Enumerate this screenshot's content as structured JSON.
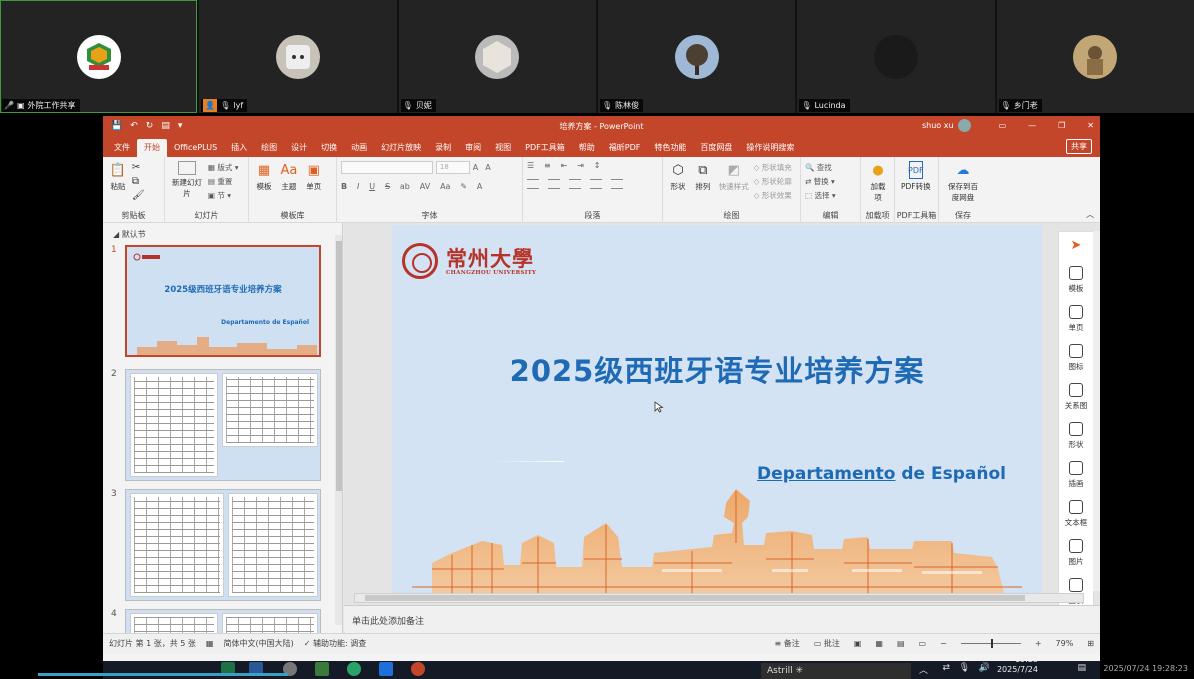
{
  "participants": [
    {
      "name": "外院工作共享",
      "active": true,
      "avatar": "university-logo"
    },
    {
      "name": "lyf",
      "active": false,
      "avatar": "cat-photo"
    },
    {
      "name": "贝妮",
      "active": false,
      "avatar": "hexagon-photo"
    },
    {
      "name": "陈林俊",
      "active": false,
      "avatar": "tree-photo"
    },
    {
      "name": "Lucinda",
      "active": false,
      "avatar": "dark-circle"
    },
    {
      "name": "乡门老",
      "active": false,
      "avatar": "painting-photo"
    }
  ],
  "window": {
    "title": "培养方案 - PowerPoint",
    "user": "shuo xu",
    "share": "共享"
  },
  "tabs": [
    "文件",
    "开始",
    "OfficePLUS",
    "插入",
    "绘图",
    "设计",
    "切换",
    "动画",
    "幻灯片放映",
    "录制",
    "审阅",
    "视图",
    "PDF工具箱",
    "帮助",
    "福昕PDF",
    "特色功能",
    "百度网盘",
    "操作说明搜索"
  ],
  "selected_tab": "开始",
  "ribbon": {
    "clipboard": {
      "paste": "粘贴",
      "label": "剪贴板"
    },
    "slides": {
      "new_slide": "新建幻灯片",
      "layout": "版式",
      "reset": "重置",
      "section": "节",
      "label": "幻灯片"
    },
    "templates": {
      "template": "模板",
      "theme": "主题",
      "single": "单页",
      "label": "模板库"
    },
    "font": {
      "label": "字体",
      "size": "18"
    },
    "paragraph": {
      "label": "段落"
    },
    "drawing": {
      "shape": "形状",
      "arrange": "排列",
      "quick_styles": "快速样式",
      "fill": "形状填充",
      "outline": "形状轮廓",
      "effect": "形状效果",
      "label": "绘图"
    },
    "editing": {
      "find": "查找",
      "replace": "替换",
      "select": "选择",
      "label": "编辑"
    },
    "addins": {
      "load": "加载项",
      "label": "加载项"
    },
    "pdf": {
      "convert": "PDF转换",
      "label": "PDF工具箱"
    },
    "save": {
      "save_to": "保存到百度网盘",
      "label": "保存"
    }
  },
  "thumbnails": {
    "section": "默认节",
    "items": [
      {
        "num": "1",
        "title": "2025级西班牙语专业培养方案",
        "dept": "Departamento de Español"
      },
      {
        "num": "2"
      },
      {
        "num": "3"
      },
      {
        "num": "4"
      }
    ]
  },
  "slide": {
    "logo_cn": "常州大學",
    "logo_en": "CHANGZHOU UNIVERSITY",
    "title": "2025级西班牙语专业培养方案",
    "dept_a": "Departamento",
    "dept_b": " de Español"
  },
  "side_panel": [
    "模板",
    "单页",
    "图标",
    "关系图",
    "形状",
    "插画",
    "文本框",
    "图片",
    "图表"
  ],
  "notes_placeholder": "单击此处添加备注",
  "status": {
    "slide_info": "幻灯片 第 1 张，共 5 张",
    "language": "简体中文(中国大陆)",
    "accessibility": "辅助功能: 调查",
    "notes": "备注",
    "comments": "批注",
    "zoom": "79%"
  },
  "taskbar": {
    "popup": "Astrill",
    "time": "19:28",
    "date": "2025/7/24"
  },
  "timestamp": "2025/07/24 19:28:23",
  "colors": {
    "accent": "#c4462a",
    "title_blue": "#1f6ab5",
    "seal_red": "#b5332a"
  }
}
